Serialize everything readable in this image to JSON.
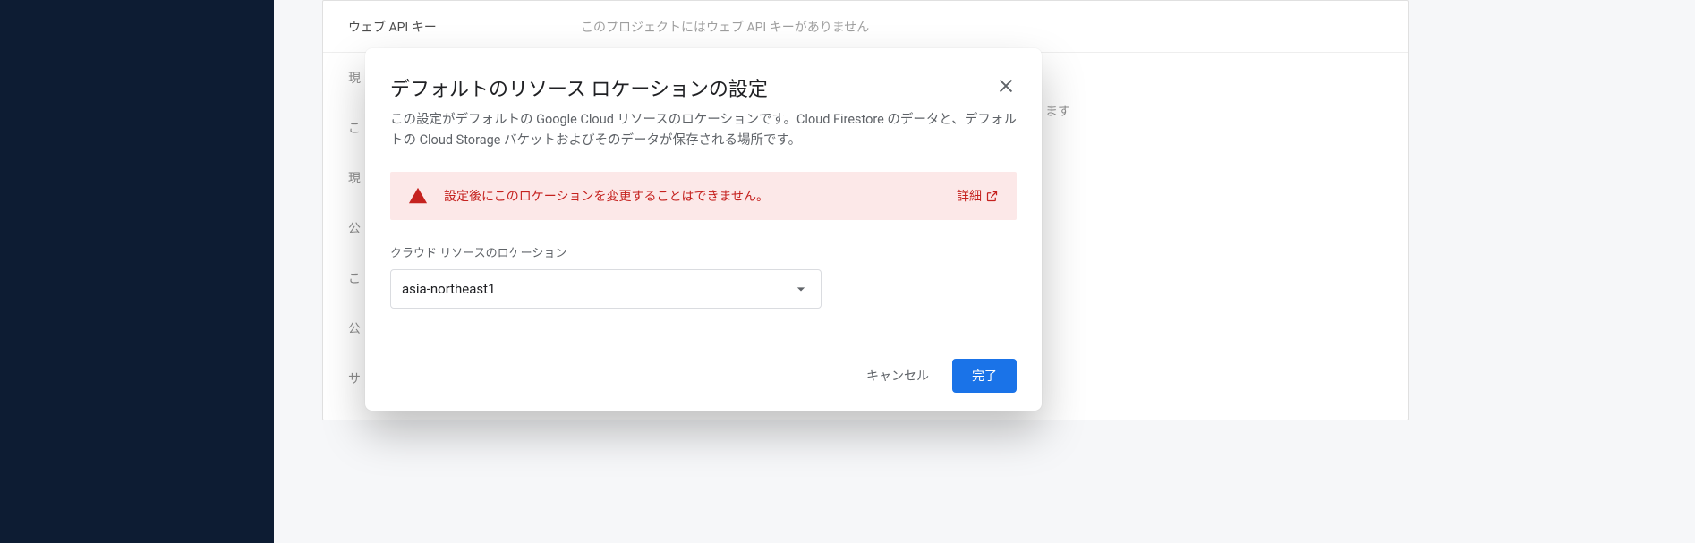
{
  "background": {
    "row1_label": "ウェブ API キー",
    "row1_value": "このプロジェクトにはウェブ API キーがありません",
    "ghost1": "現",
    "ghost2": "こ",
    "ghost3": "現",
    "ghost4": "公",
    "ghost5": "こ",
    "ghost6": "公",
    "ghost7": "サ",
    "outside": "ます"
  },
  "dialog": {
    "title": "デフォルトのリソース ロケーションの設定",
    "description": "この設定がデフォルトの Google Cloud リソースのロケーションです。Cloud Firestore のデータと、デフォルトの Cloud Storage バケットおよびそのデータが保存される場所です。",
    "warning_text": "設定後にこのロケーションを変更することはできません。",
    "warning_link": "詳細",
    "field_label": "クラウド リソースのロケーション",
    "selected_value": "asia-northeast1",
    "cancel": "キャンセル",
    "done": "完了"
  }
}
